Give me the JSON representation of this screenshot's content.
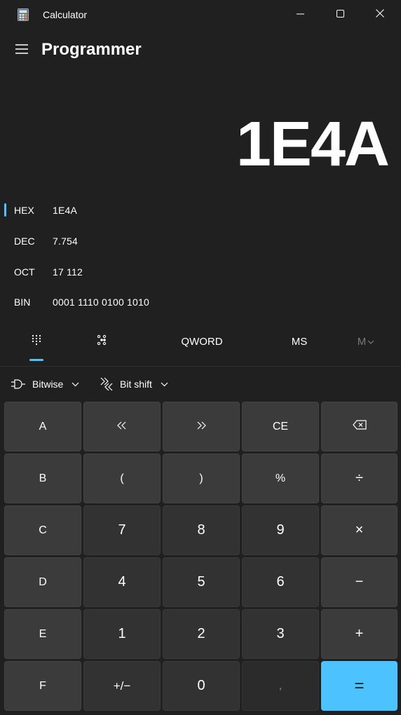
{
  "window": {
    "title": "Calculator",
    "icon": "calculator-icon",
    "controls": [
      "minimize-icon",
      "maximize-icon",
      "close-icon"
    ]
  },
  "header": {
    "menu_icon": "hamburger-menu-icon",
    "mode": "Programmer"
  },
  "display": {
    "value": "1E4A"
  },
  "radix": {
    "active": "HEX",
    "rows": [
      {
        "name": "HEX",
        "value": "1E4A"
      },
      {
        "name": "DEC",
        "value": "7.754"
      },
      {
        "name": "OCT",
        "value": "17 112"
      },
      {
        "name": "BIN",
        "value": "0001 1110 0100 1010"
      }
    ]
  },
  "mode_bar": {
    "keypad_icon": "full-keypad-icon",
    "bit_toggle_icon": "bit-toggling-keypad-icon",
    "word_size": "QWORD",
    "memory_store": "MS",
    "memory_recall": "M"
  },
  "toolbar": {
    "bitwise": "Bitwise",
    "bitshift": "Bit shift"
  },
  "keys": {
    "row1": [
      "A",
      "«",
      "»",
      "CE",
      "⌫"
    ],
    "row2": [
      "B",
      "(",
      ")",
      "%",
      "÷"
    ],
    "row3": [
      "C",
      "7",
      "8",
      "9",
      "×"
    ],
    "row4": [
      "D",
      "4",
      "5",
      "6",
      "−"
    ],
    "row5": [
      "E",
      "1",
      "2",
      "3",
      "+"
    ],
    "row6": [
      "F",
      "+/−",
      "0",
      ",",
      "="
    ]
  },
  "colors": {
    "background": "#202020",
    "key": "#3b3b3b",
    "number_key": "#323232",
    "accent": "#4cc2ff"
  }
}
